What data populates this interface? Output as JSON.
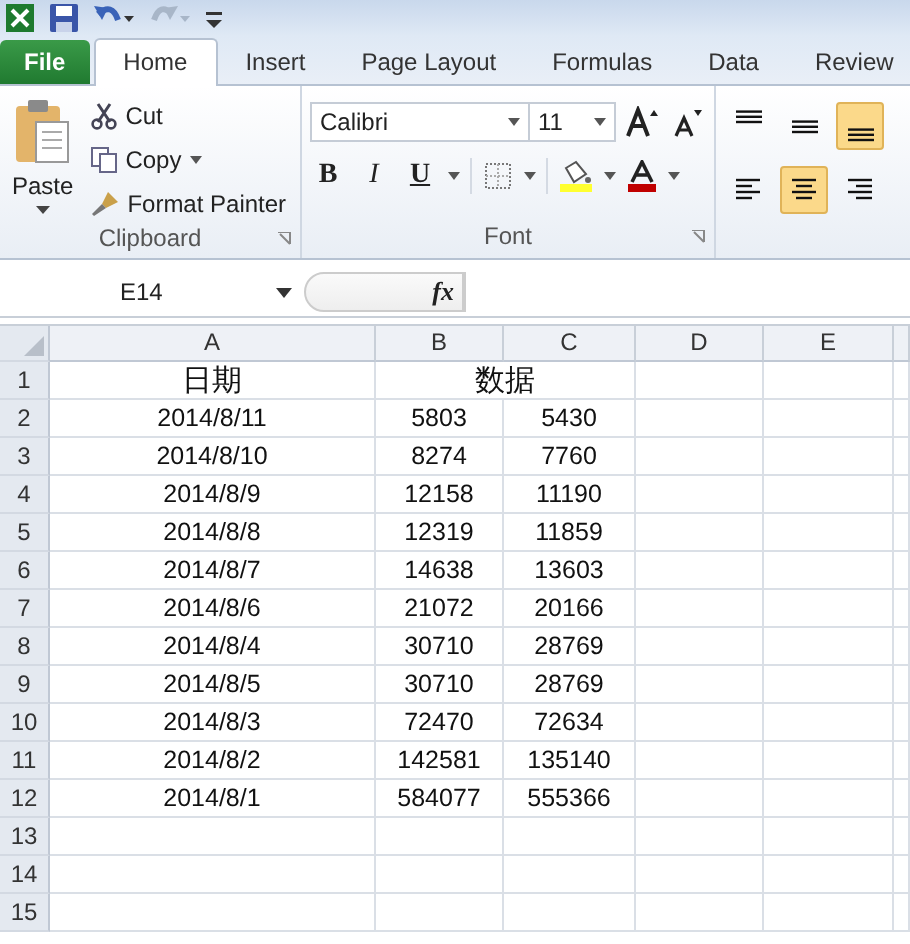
{
  "tabs": [
    {
      "label": "File",
      "kind": "file",
      "selected": false
    },
    {
      "label": "Home",
      "kind": "tab",
      "selected": true
    },
    {
      "label": "Insert",
      "kind": "tab",
      "selected": false
    },
    {
      "label": "Page Layout",
      "kind": "tab",
      "selected": false
    },
    {
      "label": "Formulas",
      "kind": "tab",
      "selected": false
    },
    {
      "label": "Data",
      "kind": "tab",
      "selected": false
    },
    {
      "label": "Review",
      "kind": "tab",
      "selected": false
    }
  ],
  "clipboard": {
    "paste": "Paste",
    "cut": "Cut",
    "copy": "Copy",
    "format_painter": "Format Painter",
    "label": "Clipboard"
  },
  "font": {
    "name": "Calibri",
    "size": "11",
    "bold": "B",
    "italic": "I",
    "underline": "U",
    "label": "Font"
  },
  "alignment": {
    "vertical": [
      {
        "kind": "top",
        "selected": false
      },
      {
        "kind": "middle",
        "selected": false
      },
      {
        "kind": "bottom",
        "selected": true
      }
    ],
    "horizontal": [
      {
        "kind": "left",
        "selected": false
      },
      {
        "kind": "center",
        "selected": true
      },
      {
        "kind": "right",
        "selected": false
      }
    ]
  },
  "formula_bar": {
    "name_box": "E14",
    "fx": "fx"
  },
  "columns": [
    "A",
    "B",
    "C",
    "D",
    "E"
  ],
  "rows": [
    {
      "number": "1",
      "kind": "header",
      "cells": [
        "日期",
        "数据"
      ]
    },
    {
      "number": "2",
      "kind": "data",
      "cells": [
        "2014/8/11",
        "5803",
        "5430"
      ]
    },
    {
      "number": "3",
      "kind": "data",
      "cells": [
        "2014/8/10",
        "8274",
        "7760"
      ]
    },
    {
      "number": "4",
      "kind": "data",
      "cells": [
        "2014/8/9",
        "12158",
        "11190"
      ]
    },
    {
      "number": "5",
      "kind": "data",
      "cells": [
        "2014/8/8",
        "12319",
        "11859"
      ]
    },
    {
      "number": "6",
      "kind": "data",
      "cells": [
        "2014/8/7",
        "14638",
        "13603"
      ]
    },
    {
      "number": "7",
      "kind": "data",
      "cells": [
        "2014/8/6",
        "21072",
        "20166"
      ]
    },
    {
      "number": "8",
      "kind": "data",
      "cells": [
        "2014/8/4",
        "30710",
        "28769"
      ]
    },
    {
      "number": "9",
      "kind": "data",
      "cells": [
        "2014/8/5",
        "30710",
        "28769"
      ]
    },
    {
      "number": "10",
      "kind": "data",
      "cells": [
        "2014/8/3",
        "72470",
        "72634"
      ]
    },
    {
      "number": "11",
      "kind": "data",
      "cells": [
        "2014/8/2",
        "142581",
        "135140"
      ]
    },
    {
      "number": "12",
      "kind": "data",
      "cells": [
        "2014/8/1",
        "584077",
        "555366"
      ]
    },
    {
      "number": "13",
      "kind": "empty",
      "cells": []
    },
    {
      "number": "14",
      "kind": "empty",
      "cells": []
    },
    {
      "number": "15",
      "kind": "empty",
      "cells": []
    }
  ]
}
